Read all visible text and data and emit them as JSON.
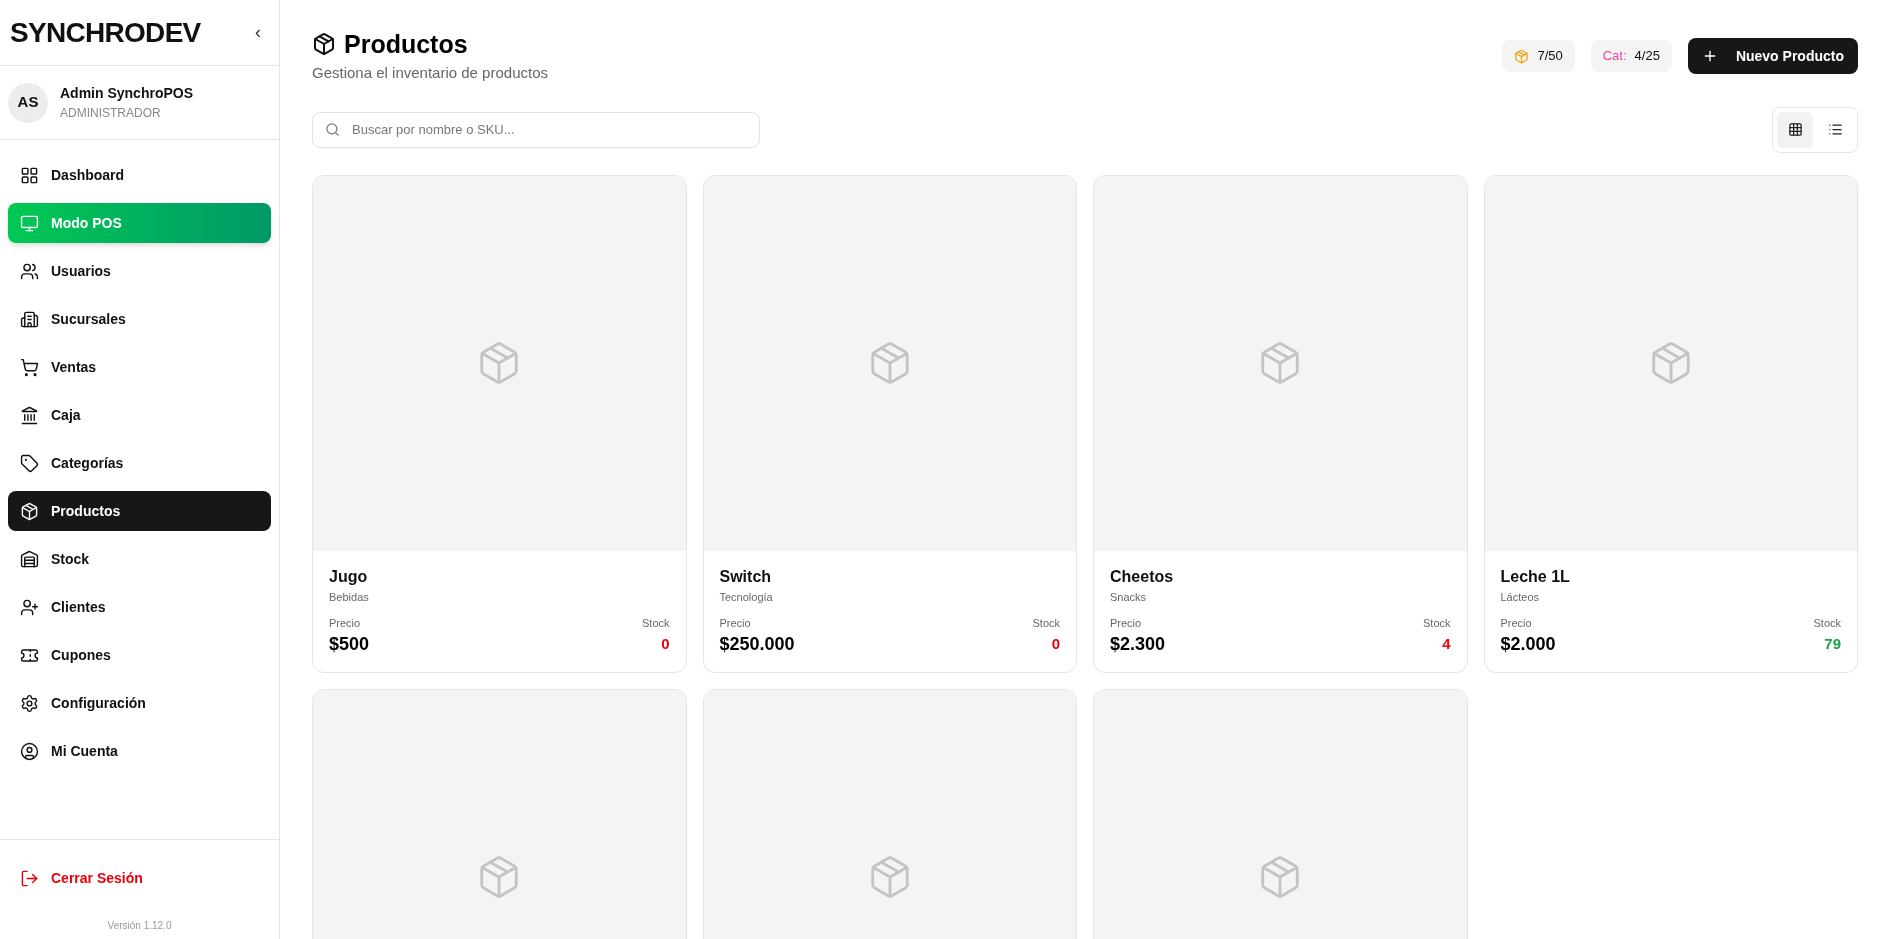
{
  "sidebar": {
    "logo": "SYNCHRODEV",
    "collapse": "‹",
    "user": {
      "initials": "AS",
      "name": "Admin SynchroPOS",
      "role": "ADMINISTRADOR"
    },
    "items": [
      {
        "label": "Dashboard",
        "kind": "link",
        "selected": false
      },
      {
        "label": "Modo POS",
        "kind": "accent",
        "selected": false
      },
      {
        "label": "Usuarios",
        "kind": "link",
        "selected": false
      },
      {
        "label": "Sucursales",
        "kind": "link",
        "selected": false
      },
      {
        "label": "Ventas",
        "kind": "link",
        "selected": false
      },
      {
        "label": "Caja",
        "kind": "link",
        "selected": false
      },
      {
        "label": "Categorías",
        "kind": "link",
        "selected": false
      },
      {
        "label": "Productos",
        "kind": "link",
        "selected": true
      },
      {
        "label": "Stock",
        "kind": "link",
        "selected": false
      },
      {
        "label": "Clientes",
        "kind": "link",
        "selected": false
      },
      {
        "label": "Cupones",
        "kind": "link",
        "selected": false
      },
      {
        "label": "Configuración",
        "kind": "link",
        "selected": false
      },
      {
        "label": "Mi Cuenta",
        "kind": "link",
        "selected": false
      }
    ],
    "logout": "Cerrar Sesión",
    "version": "Versión 1.12.0"
  },
  "header": {
    "title": "Productos",
    "subtitle": "Gestiona el inventario de productos",
    "product_count": "7/50",
    "category_label": "Cat:",
    "category_count": "4/25",
    "new_button": "Nuevo Producto"
  },
  "search": {
    "placeholder": "Buscar por nombre o SKU..."
  },
  "view_toggle": [
    {
      "kind": "grid",
      "selected": true
    },
    {
      "kind": "list",
      "selected": false
    }
  ],
  "products": [
    {
      "name": "Jugo",
      "category": "Bebidas",
      "price_label": "Precio",
      "price": "$500",
      "stock_label": "Stock",
      "stock": "0",
      "color": "#e7000b",
      "kind": "placeholder"
    },
    {
      "name": "Switch",
      "category": "Tecnología",
      "price_label": "Precio",
      "price": "$250.000",
      "stock_label": "Stock",
      "stock": "0",
      "color": "#e7000b",
      "kind": "placeholder"
    },
    {
      "name": "Cheetos",
      "category": "Snacks",
      "price_label": "Precio",
      "price": "$2.300",
      "stock_label": "Stock",
      "stock": "4",
      "color": "#e7000b",
      "kind": "placeholder"
    },
    {
      "name": "Leche 1L",
      "category": "Lácteos",
      "price_label": "Precio",
      "price": "$2.000",
      "stock_label": "Stock",
      "stock": "79",
      "color": "#16a34a",
      "kind": "placeholder"
    },
    {
      "kind": "placeholder"
    },
    {
      "kind": "placeholder"
    },
    {
      "kind": "placeholder"
    }
  ]
}
